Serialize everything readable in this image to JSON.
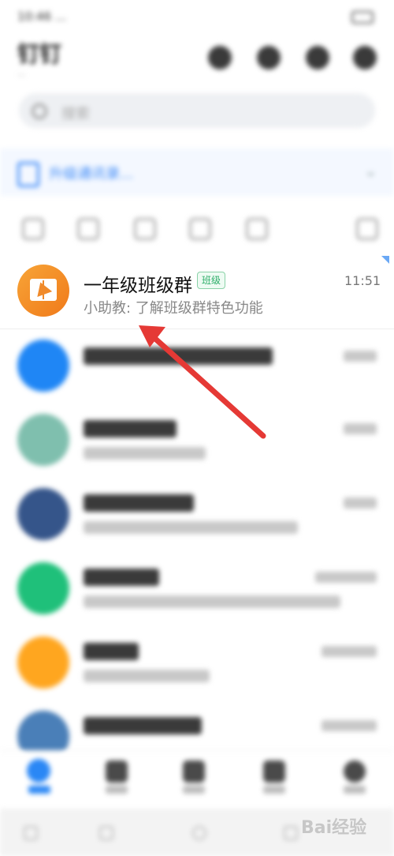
{
  "status_bar": {
    "time": "10:46 ..."
  },
  "header": {
    "title": "钉钉",
    "subtitle": "..."
  },
  "search": {
    "placeholder": "搜索"
  },
  "banner": {
    "text": "升级通讯录..."
  },
  "chats": [
    {
      "name": "一年级班级群",
      "tag": "班级",
      "time": "11:51",
      "preview": "小助教: 了解班级群特色功能",
      "avatar_color": "#F28A24"
    }
  ],
  "watermark": {
    "text": "Bai经验"
  },
  "colors": {
    "accent": "#3D8AF7",
    "arrow": "#E53935",
    "tag_green": "#2FAE6A"
  }
}
